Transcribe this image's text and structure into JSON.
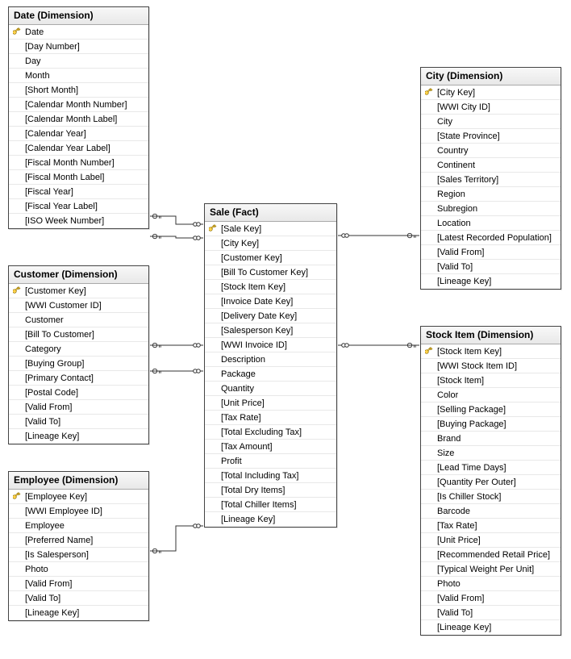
{
  "tables": {
    "date": {
      "title": "Date (Dimension)",
      "columns": [
        {
          "key": true,
          "label": "Date"
        },
        {
          "key": false,
          "label": "[Day Number]"
        },
        {
          "key": false,
          "label": "Day"
        },
        {
          "key": false,
          "label": "Month"
        },
        {
          "key": false,
          "label": "[Short Month]"
        },
        {
          "key": false,
          "label": "[Calendar Month Number]"
        },
        {
          "key": false,
          "label": "[Calendar Month Label]"
        },
        {
          "key": false,
          "label": "[Calendar Year]"
        },
        {
          "key": false,
          "label": "[Calendar Year Label]"
        },
        {
          "key": false,
          "label": "[Fiscal Month Number]"
        },
        {
          "key": false,
          "label": "[Fiscal Month Label]"
        },
        {
          "key": false,
          "label": "[Fiscal Year]"
        },
        {
          "key": false,
          "label": "[Fiscal Year Label]"
        },
        {
          "key": false,
          "label": "[ISO Week Number]"
        }
      ]
    },
    "customer": {
      "title": "Customer (Dimension)",
      "columns": [
        {
          "key": true,
          "label": "[Customer Key]"
        },
        {
          "key": false,
          "label": "[WWI Customer ID]"
        },
        {
          "key": false,
          "label": "Customer"
        },
        {
          "key": false,
          "label": "[Bill To Customer]"
        },
        {
          "key": false,
          "label": "Category"
        },
        {
          "key": false,
          "label": "[Buying Group]"
        },
        {
          "key": false,
          "label": "[Primary Contact]"
        },
        {
          "key": false,
          "label": "[Postal Code]"
        },
        {
          "key": false,
          "label": "[Valid From]"
        },
        {
          "key": false,
          "label": "[Valid To]"
        },
        {
          "key": false,
          "label": "[Lineage Key]"
        }
      ]
    },
    "employee": {
      "title": "Employee (Dimension)",
      "columns": [
        {
          "key": true,
          "label": "[Employee Key]"
        },
        {
          "key": false,
          "label": "[WWI Employee ID]"
        },
        {
          "key": false,
          "label": "Employee"
        },
        {
          "key": false,
          "label": "[Preferred Name]"
        },
        {
          "key": false,
          "label": "[Is Salesperson]"
        },
        {
          "key": false,
          "label": "Photo"
        },
        {
          "key": false,
          "label": "[Valid From]"
        },
        {
          "key": false,
          "label": "[Valid To]"
        },
        {
          "key": false,
          "label": "[Lineage Key]"
        }
      ]
    },
    "sale": {
      "title": "Sale (Fact)",
      "columns": [
        {
          "key": true,
          "label": "[Sale Key]"
        },
        {
          "key": false,
          "label": "[City Key]"
        },
        {
          "key": false,
          "label": "[Customer Key]"
        },
        {
          "key": false,
          "label": "[Bill To Customer Key]"
        },
        {
          "key": false,
          "label": "[Stock Item Key]"
        },
        {
          "key": false,
          "label": "[Invoice Date Key]"
        },
        {
          "key": false,
          "label": "[Delivery Date Key]"
        },
        {
          "key": false,
          "label": "[Salesperson Key]"
        },
        {
          "key": false,
          "label": "[WWI Invoice ID]"
        },
        {
          "key": false,
          "label": "Description"
        },
        {
          "key": false,
          "label": "Package"
        },
        {
          "key": false,
          "label": "Quantity"
        },
        {
          "key": false,
          "label": "[Unit Price]"
        },
        {
          "key": false,
          "label": "[Tax Rate]"
        },
        {
          "key": false,
          "label": "[Total Excluding Tax]"
        },
        {
          "key": false,
          "label": "[Tax Amount]"
        },
        {
          "key": false,
          "label": "Profit"
        },
        {
          "key": false,
          "label": "[Total Including Tax]"
        },
        {
          "key": false,
          "label": "[Total Dry Items]"
        },
        {
          "key": false,
          "label": "[Total Chiller Items]"
        },
        {
          "key": false,
          "label": "[Lineage Key]"
        }
      ]
    },
    "city": {
      "title": "City (Dimension)",
      "columns": [
        {
          "key": true,
          "label": "[City Key]"
        },
        {
          "key": false,
          "label": "[WWI City ID]"
        },
        {
          "key": false,
          "label": "City"
        },
        {
          "key": false,
          "label": "[State Province]"
        },
        {
          "key": false,
          "label": "Country"
        },
        {
          "key": false,
          "label": "Continent"
        },
        {
          "key": false,
          "label": "[Sales Territory]"
        },
        {
          "key": false,
          "label": "Region"
        },
        {
          "key": false,
          "label": "Subregion"
        },
        {
          "key": false,
          "label": "Location"
        },
        {
          "key": false,
          "label": "[Latest Recorded Population]"
        },
        {
          "key": false,
          "label": "[Valid From]"
        },
        {
          "key": false,
          "label": "[Valid To]"
        },
        {
          "key": false,
          "label": "[Lineage Key]"
        }
      ]
    },
    "stockitem": {
      "title": "Stock Item (Dimension)",
      "columns": [
        {
          "key": true,
          "label": "[Stock Item Key]"
        },
        {
          "key": false,
          "label": "[WWI Stock Item ID]"
        },
        {
          "key": false,
          "label": "[Stock Item]"
        },
        {
          "key": false,
          "label": "Color"
        },
        {
          "key": false,
          "label": "[Selling Package]"
        },
        {
          "key": false,
          "label": "[Buying Package]"
        },
        {
          "key": false,
          "label": "Brand"
        },
        {
          "key": false,
          "label": "Size"
        },
        {
          "key": false,
          "label": "[Lead Time Days]"
        },
        {
          "key": false,
          "label": "[Quantity Per Outer]"
        },
        {
          "key": false,
          "label": "[Is Chiller Stock]"
        },
        {
          "key": false,
          "label": "Barcode"
        },
        {
          "key": false,
          "label": "[Tax Rate]"
        },
        {
          "key": false,
          "label": "[Unit Price]"
        },
        {
          "key": false,
          "label": "[Recommended Retail Price]"
        },
        {
          "key": false,
          "label": "[Typical Weight Per Unit]"
        },
        {
          "key": false,
          "label": "Photo"
        },
        {
          "key": false,
          "label": "[Valid From]"
        },
        {
          "key": false,
          "label": "[Valid To]"
        },
        {
          "key": false,
          "label": "[Lineage Key]"
        }
      ]
    }
  }
}
